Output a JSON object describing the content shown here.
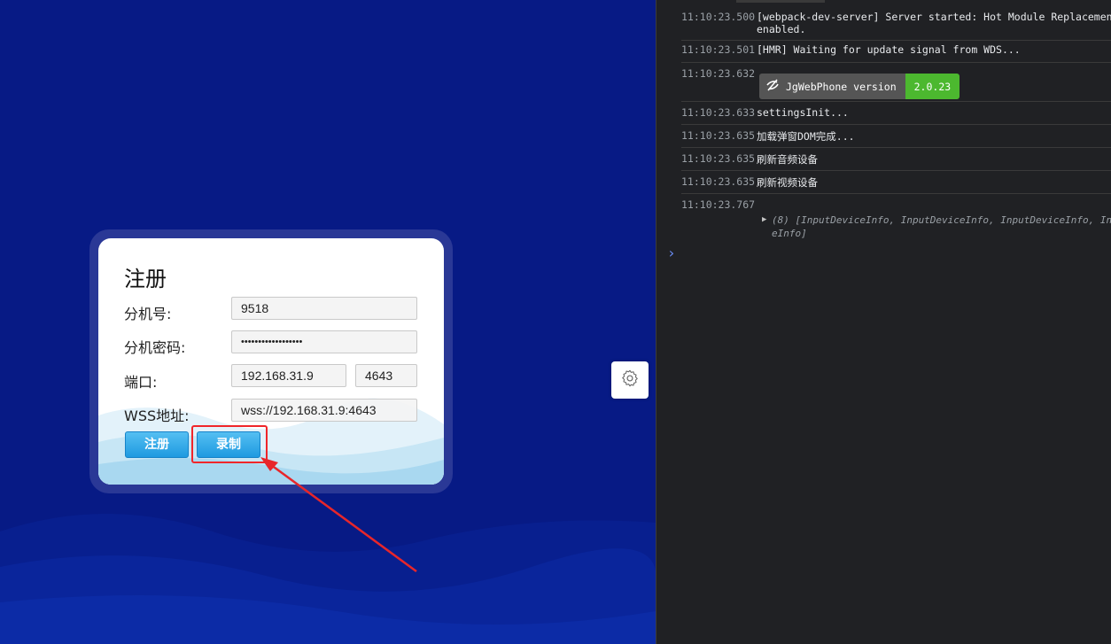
{
  "form": {
    "title": "注册",
    "ext_label": "分机号:",
    "ext_value": "9518",
    "password_label": "分机密码:",
    "password_value": "••••••••••••••••••",
    "port_label": "端口:",
    "port_host": "192.168.31.9",
    "port_number": "4643",
    "wss_label": "WSS地址:",
    "wss_value": "wss://192.168.31.9:4643",
    "register_button": "注册",
    "record_button": "录制"
  },
  "settings": {
    "icon": "gear-icon"
  },
  "console": {
    "logs": [
      {
        "time": "11:10:23.500",
        "text": "[webpack-dev-server] Server started: Hot Module Replacement e\nenabled."
      },
      {
        "time": "11:10:23.501",
        "text": "[HMR] Waiting for update signal from WDS..."
      },
      {
        "time": "11:10:23.632",
        "badge_name": "JgWebPhone version",
        "badge_version": "2.0.23"
      },
      {
        "time": "11:10:23.633",
        "text": "settingsInit..."
      },
      {
        "time": "11:10:23.635",
        "text": "加载弹窗DOM完成..."
      },
      {
        "time": "11:10:23.635",
        "text": "刷新音频设备"
      },
      {
        "time": "11:10:23.635",
        "text": "刷新视频设备"
      },
      {
        "time": "11:10:23.767",
        "object_line1": "(8) [InputDeviceInfo, InputDeviceInfo, InputDeviceInfo, In",
        "object_line2": "eInfo]"
      }
    ],
    "prompt": "›"
  },
  "colors": {
    "background": "#071a85",
    "button": "#1e9ae0",
    "highlight": "#f0262a",
    "badge_green": "#4cb82f"
  }
}
